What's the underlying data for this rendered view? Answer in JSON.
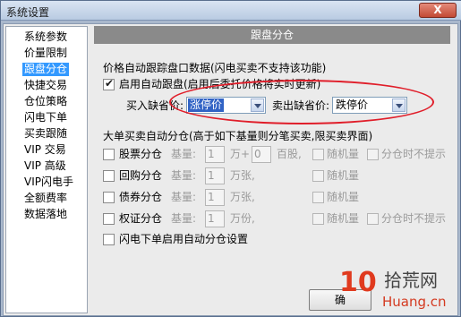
{
  "window": {
    "title": "系统设置",
    "close_label": "X"
  },
  "nav": {
    "items": [
      "系统参数",
      "价量限制",
      "跟盘分仓",
      "快捷交易",
      "仓位策略",
      "闪电下单",
      "买卖跟随",
      "VIP 交易",
      "VIP 高级",
      "VIP闪电手",
      "全额费率",
      "数据落地"
    ],
    "selected_index": 2
  },
  "panel": {
    "header": "跟盘分仓",
    "auto_follow": {
      "section_label": "价格自动跟踪盘口数据(闪电买卖不支持该功能)",
      "enable_label": "启用自动跟盘(启用后委托价格将实时更新)",
      "enable_checked": true,
      "buy_label": "买入缺省价:",
      "buy_value": "涨停价",
      "sell_label": "卖出缺省价:",
      "sell_value": "跌停价"
    },
    "split": {
      "section_label": "大单买卖自动分仓(高于如下基量则分笔买卖,限买卖界面)",
      "base_label": "基量:",
      "random_label": "随机量",
      "no_prompt_label": "分仓时不提示",
      "rows": [
        {
          "label": "股票分仓",
          "base": "1",
          "unit": "万+",
          "extra_value": "0",
          "extra_unit": "百股,"
        },
        {
          "label": "回购分仓",
          "base": "1",
          "unit": "万张,"
        },
        {
          "label": "债券分仓",
          "base": "1",
          "unit": "万张,"
        },
        {
          "label": "权证分仓",
          "base": "1",
          "unit": "万份,"
        }
      ],
      "lightning_label": "闪电下单启用自动分仓设置"
    },
    "confirm_label": "确"
  },
  "watermark": {
    "badge": "10",
    "cn": "拾荒网",
    "en": "Huang.cn"
  },
  "colors": {
    "highlight": "#e01e2a",
    "selection": "#3399ff",
    "header_bg": "#8a8a8a"
  }
}
